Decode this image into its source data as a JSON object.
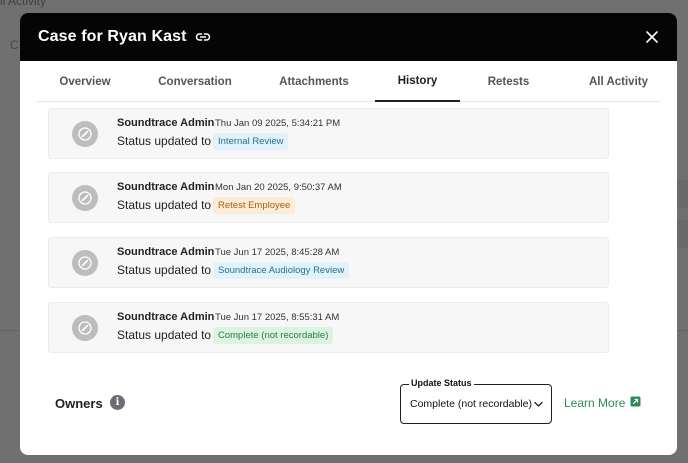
{
  "background": {
    "top_text": "ll Activity",
    "left_text": "C"
  },
  "modal": {
    "title": "Case for Ryan Kast",
    "close_label": "×"
  },
  "tabs": [
    {
      "label": "Overview"
    },
    {
      "label": "Conversation"
    },
    {
      "label": "Attachments"
    },
    {
      "label": "History"
    },
    {
      "label": "Retests"
    },
    {
      "label": "All Activity"
    }
  ],
  "active_tab": "History",
  "history": [
    {
      "author": "Soundtrace Admin",
      "time": "Thu Jan 09 2025, 5:34:21 PM",
      "action": "Status updated to",
      "status": "Internal Review",
      "status_bg": "#e2f2fa",
      "status_fg": "#2a6f8e"
    },
    {
      "author": "Soundtrace Admin",
      "time": "Mon Jan 20 2025, 9:50:37 AM",
      "action": "Status updated to",
      "status": "Retest Employee",
      "status_bg": "#fcebd5",
      "status_fg": "#a4621c"
    },
    {
      "author": "Soundtrace Admin",
      "time": "Tue Jun 17 2025, 8:45:28 AM",
      "action": "Status updated to",
      "status": "Soundtrace Audiology Review",
      "status_bg": "#e2f2fa",
      "status_fg": "#2a6f8e"
    },
    {
      "author": "Soundtrace Admin",
      "time": "Tue Jun 17 2025, 8:55:31 AM",
      "action": "Status updated to",
      "status": "Complete (not recordable)",
      "status_bg": "#dcf3e2",
      "status_fg": "#2c7a45"
    }
  ],
  "footer": {
    "owners_label": "Owners",
    "info_glyph": "i",
    "update_status_label": "Update Status",
    "update_status_value": "Complete (not recordable)",
    "learn_more": "Learn More"
  },
  "colors": {
    "header_bg": "#050505",
    "accent_green": "#2e8b57",
    "avatar_gray": "#bdbdbd"
  }
}
